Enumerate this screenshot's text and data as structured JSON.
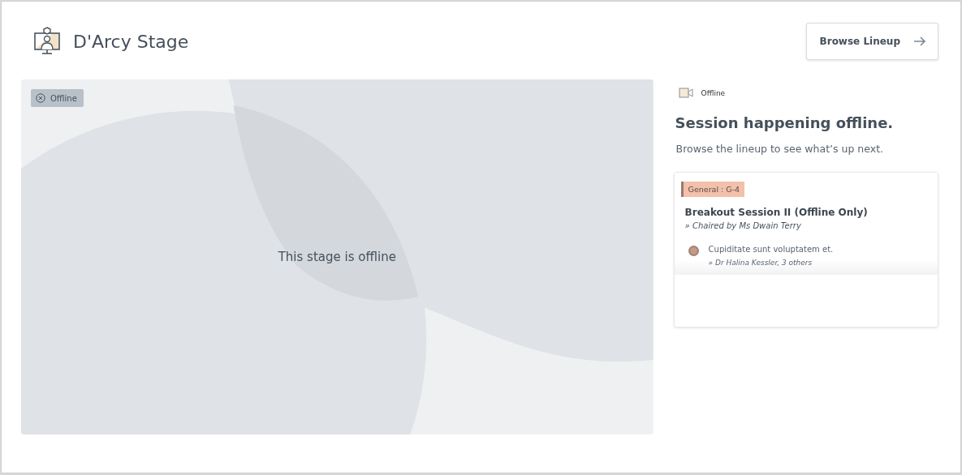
{
  "header": {
    "title": "D'Arcy Stage",
    "browse_button": "Browse Lineup"
  },
  "stage": {
    "badge": "Offline",
    "message": "This stage is offline"
  },
  "status": {
    "label": "Offline",
    "heading": "Session happening offline.",
    "subtext": "Browse the lineup to see what’s up next."
  },
  "session": {
    "tag": "General : G-4",
    "title": "Breakout Session II (Offline Only)",
    "chair": "» Chaired by Ms Dwain Terry",
    "items": [
      {
        "title": "Cupiditate sunt voluptatem et.",
        "speakers": "» Dr Halina Kessler, 3 others"
      }
    ]
  }
}
